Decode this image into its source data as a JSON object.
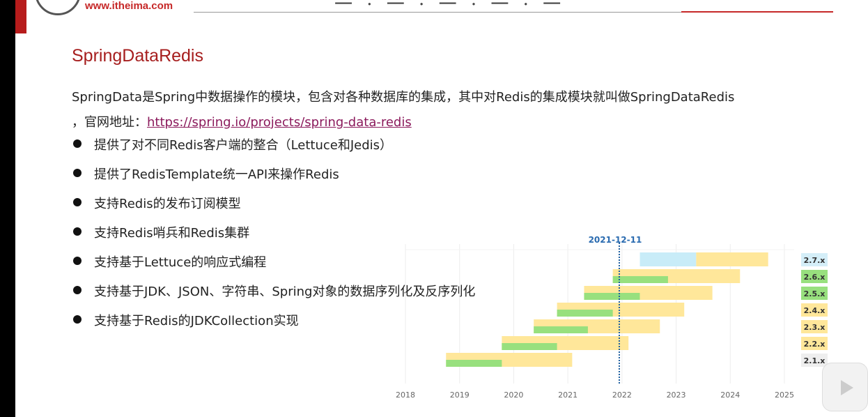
{
  "header": {
    "site_url": "www.itheima.com"
  },
  "slide": {
    "title": "SpringDataRedis",
    "intro": "SpringData是Spring中数据操作的模块，包含对各种数据库的集成，其中对Redis的集成模块就叫做SpringDataRedis",
    "intro_cont": "，官网地址：",
    "link": "https://spring.io/projects/spring-data-redis",
    "bullets": [
      "提供了对不同Redis客户端的整合（Lettuce和Jedis）",
      "提供了RedisTemplate统一API来操作Redis",
      "支持Redis的发布订阅模型",
      "支持Redis哨兵和Redis集群",
      "支持基于Lettuce的响应式编程",
      "支持基于JDK、JSON、字符串、Spring对象的数据序列化及反序列化",
      "支持基于Redis的JDKCollection实现"
    ]
  },
  "chart_data": {
    "type": "bar",
    "marker_label": "2021-12-11",
    "marker_date": 2021.95,
    "x_ticks": [
      "2018",
      "2019",
      "2020",
      "2021",
      "2022",
      "2023",
      "2024",
      "2025"
    ],
    "xlim": [
      2018,
      2025
    ],
    "colors": {
      "green": "#98e07e",
      "yellow": "#ffe79a",
      "blue": "#c8ecf8"
    },
    "series": [
      {
        "label": "2.7.x",
        "green": null,
        "blue": [
          2022.33,
          2023.37
        ],
        "yellow": [
          2023.37,
          2024.7
        ],
        "badge_color": "#d4eef8"
      },
      {
        "label": "2.6.x",
        "green": [
          2021.83,
          2022.85
        ],
        "yellow": [
          2021.83,
          2024.18
        ],
        "badge_color": "#98e07e"
      },
      {
        "label": "2.5.x",
        "green": [
          2021.3,
          2022.33
        ],
        "yellow": [
          2021.3,
          2023.67
        ],
        "badge_color": "#98e07e"
      },
      {
        "label": "2.4.x",
        "green": [
          2020.8,
          2021.83
        ],
        "yellow": [
          2020.8,
          2023.15
        ],
        "badge_color": "#ffe79a"
      },
      {
        "label": "2.3.x",
        "green": [
          2020.37,
          2021.37
        ],
        "yellow": [
          2020.37,
          2022.7
        ],
        "badge_color": "#ffe79a"
      },
      {
        "label": "2.2.x",
        "green": [
          2019.78,
          2020.8
        ],
        "yellow": [
          2019.78,
          2022.12
        ],
        "badge_color": "#ffe79a"
      },
      {
        "label": "2.1.x",
        "green": [
          2018.75,
          2019.78
        ],
        "yellow": [
          2018.75,
          2021.08
        ],
        "badge_color": "#eeeeee"
      }
    ]
  }
}
